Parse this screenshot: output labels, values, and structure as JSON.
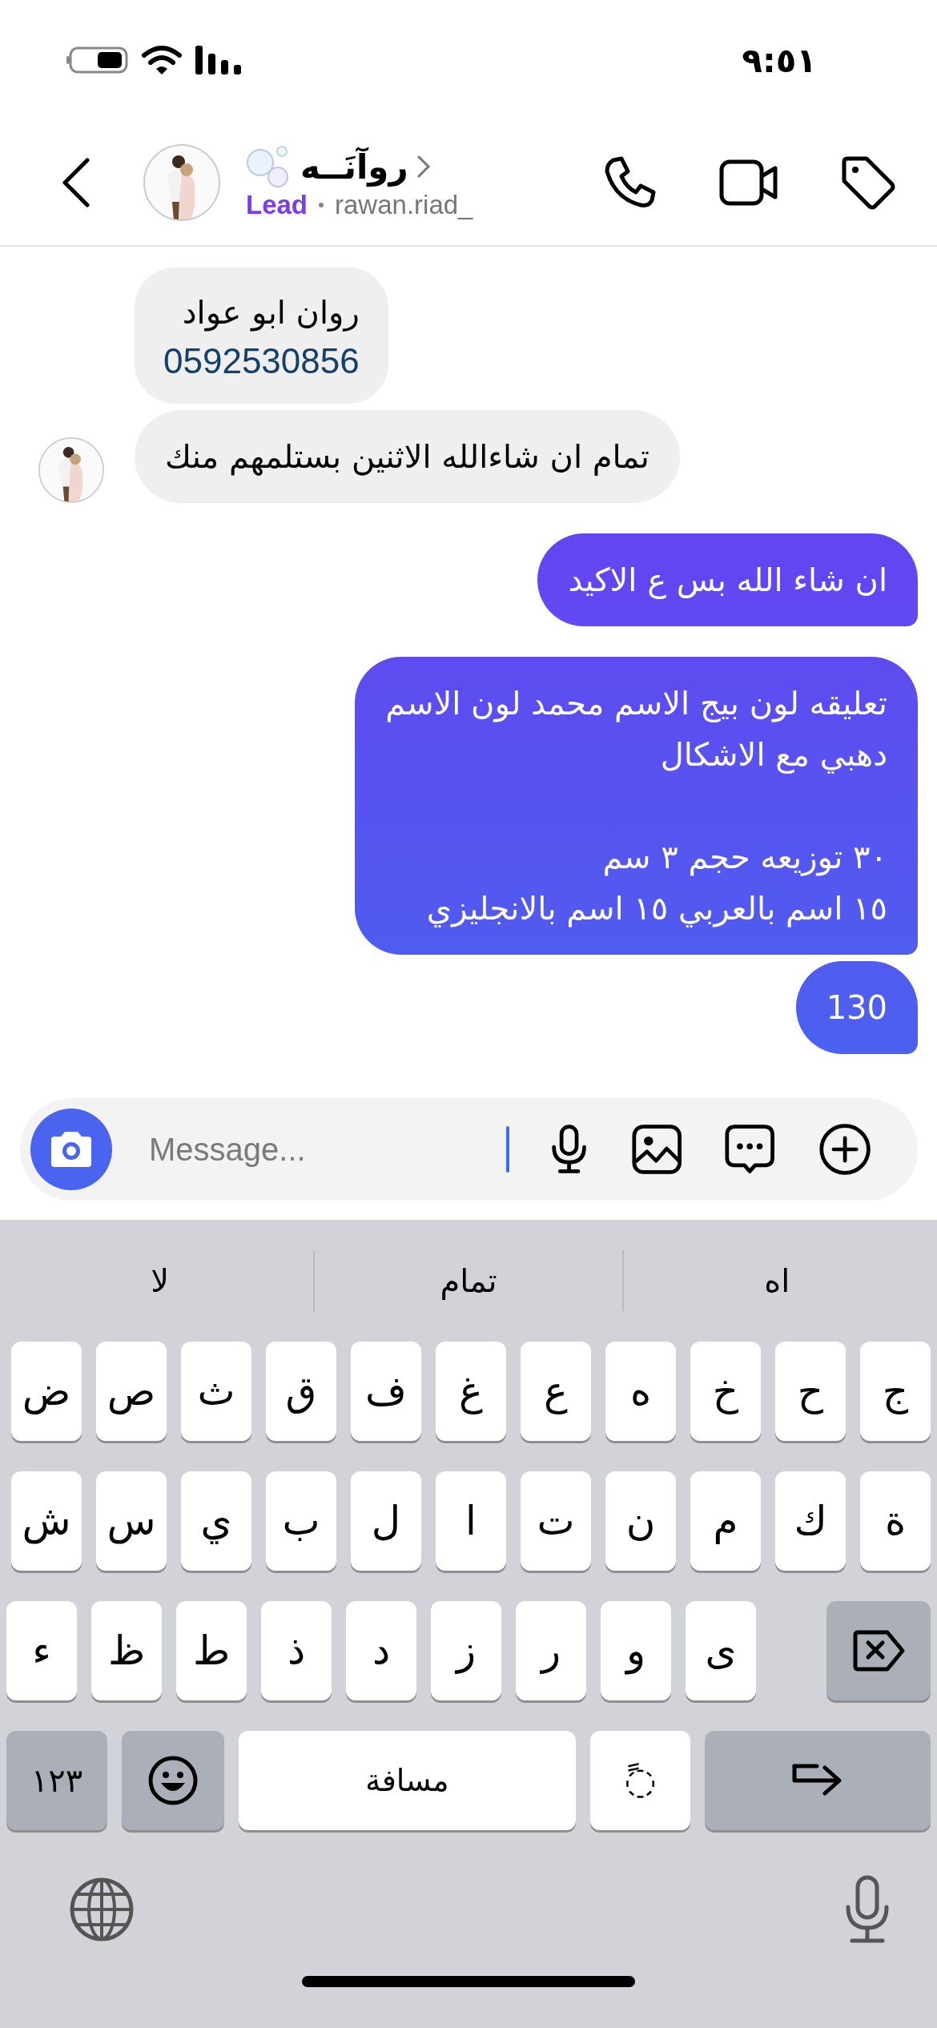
{
  "status_bar": {
    "time": "٩:٥١"
  },
  "header": {
    "name": "روآنَــه",
    "label": "Lead",
    "username": "rawan.riad_"
  },
  "messages": [
    {
      "kind": "incoming",
      "text": "روان ابو عواد",
      "link": "0592530856",
      "avatar": false
    },
    {
      "kind": "incoming",
      "text": "تمام ان شاءالله الاثنين بستلمهم منك",
      "avatar": true
    },
    {
      "kind": "outgoing",
      "text": "ان شاء الله بس ع الاكيد"
    },
    {
      "kind": "outgoing",
      "text": "تعليقه لون بيج الاسم محمد لون الاسم\nدهبي مع الاشكال\n\n٣٠ توزيعه حجم ٣ سم\n١٥ اسم بالعربي ١٥ اسم بالانجليزي"
    },
    {
      "kind": "outgoing",
      "text": "130"
    }
  ],
  "composer": {
    "placeholder": "Message..."
  },
  "suggestions": [
    "اه",
    "تمام",
    "لا"
  ],
  "keyboard": {
    "rows": [
      [
        "ج",
        "ح",
        "خ",
        "ه",
        "ع",
        "غ",
        "ف",
        "ق",
        "ث",
        "ص",
        "ض"
      ],
      [
        "ة",
        "ك",
        "م",
        "ن",
        "ت",
        "ا",
        "ل",
        "ب",
        "ي",
        "س",
        "ش"
      ]
    ],
    "shift_row": {
      "keys": [
        "ى",
        "و",
        "ر",
        "ز",
        "د",
        "ذ",
        "ط",
        "ظ",
        "ء"
      ]
    },
    "numbers_key": "١٢٣",
    "space_key": "مسافة",
    "diacritic_key": "◌ً"
  }
}
